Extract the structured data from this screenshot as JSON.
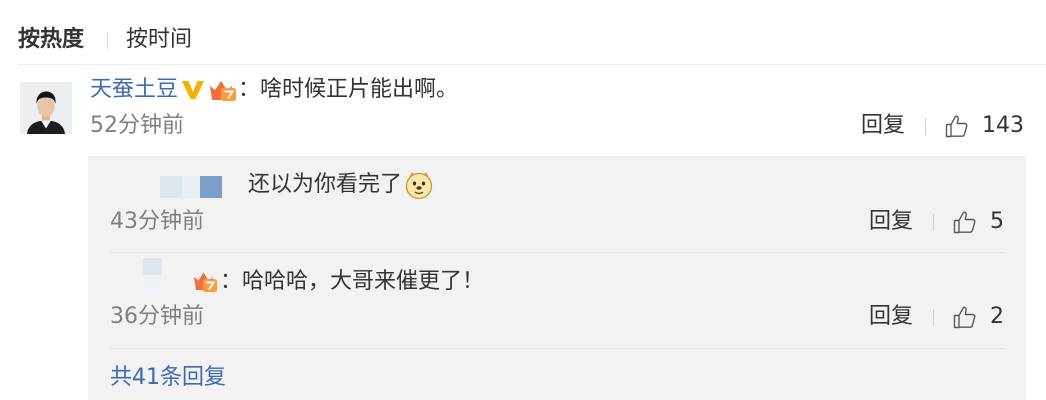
{
  "sort_tabs": {
    "hot": "按热度",
    "time": "按时间"
  },
  "comment": {
    "username": "天蚕土豆",
    "badges": [
      "verified-v-icon",
      "vip-badge-icon"
    ],
    "text": "：啥时候正片能出啊。",
    "time": "52分钟前",
    "reply_label": "回复",
    "like_count": 143
  },
  "replies": [
    {
      "text": "还以为你看完了",
      "emoji": "doge-emoji-icon",
      "time": "43分钟前",
      "reply_label": "回复",
      "like_count": 5
    },
    {
      "badge": "vip-badge-icon",
      "text": "：哈哈哈，大哥来催更了！",
      "time": "36分钟前",
      "reply_label": "回复",
      "like_count": 2
    }
  ],
  "more_replies": "共41条回复",
  "colors": {
    "link": "#3d6bb0",
    "muted": "#808080",
    "text": "#333333",
    "reply_background": "#f2f2f2",
    "verified_badge": "#f5b100",
    "vip_badge": "#f26d3d"
  }
}
